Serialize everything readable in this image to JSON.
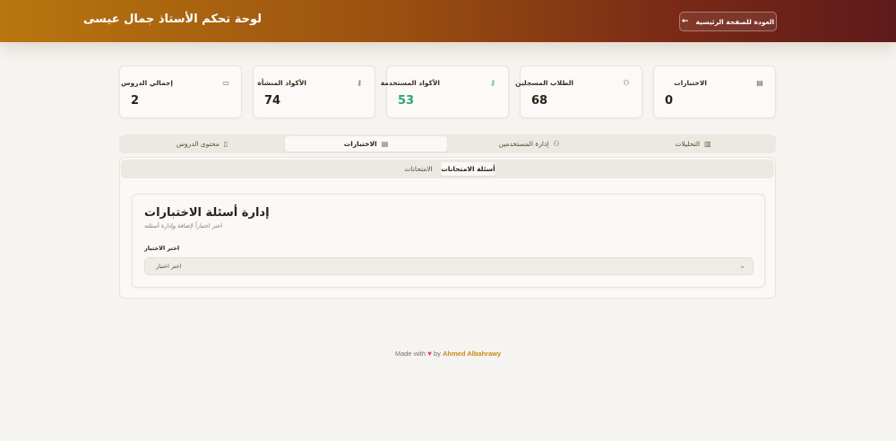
{
  "header": {
    "title": "لوحة تحكم الأستاذ جمال عيسى",
    "back_label": "العودة للصفحة الرئيسية",
    "back_icon": "←"
  },
  "stats": [
    {
      "label": "الاختبارات",
      "value": "0",
      "icon": "clipboard-icon",
      "glyph": "▤"
    },
    {
      "label": "الطلاب المسجلين",
      "value": "68",
      "icon": "users-icon",
      "glyph": "⚇"
    },
    {
      "label": "الأكواد المستخدمة",
      "value": "53",
      "icon": "key-icon",
      "glyph": "⚷",
      "color": "#2aa57a"
    },
    {
      "label": "الأكواد المنشأة",
      "value": "74",
      "icon": "key-icon",
      "glyph": "⚷"
    },
    {
      "label": "إجمالي الدروس",
      "value": "2",
      "icon": "video-icon",
      "glyph": "▭"
    }
  ],
  "tabs": [
    {
      "label": "التحليلات",
      "icon": "chart-icon",
      "glyph": "▥"
    },
    {
      "label": "إدارة المستخدمين",
      "icon": "users-icon",
      "glyph": "⚇"
    },
    {
      "label": "الاختبارات",
      "icon": "clipboard-icon",
      "glyph": "▤",
      "active": true
    },
    {
      "label": "محتوى الدروس",
      "icon": "book-icon",
      "glyph": "▯"
    }
  ],
  "subtabs": [
    {
      "label": "أسئلة الامتحانات",
      "active": true
    },
    {
      "label": "الامتحانات",
      "active": false
    }
  ],
  "card": {
    "title": "إدارة أسئلة الاختبارات",
    "description": "اختر اختباراً لإضافة وإدارة أسئلته",
    "field_label": "اختر الاختبار",
    "select_value": "اختر اختبار"
  },
  "footer": {
    "made_with": "Made with",
    "by": "by",
    "author": "Ahmed Albahrawy"
  }
}
